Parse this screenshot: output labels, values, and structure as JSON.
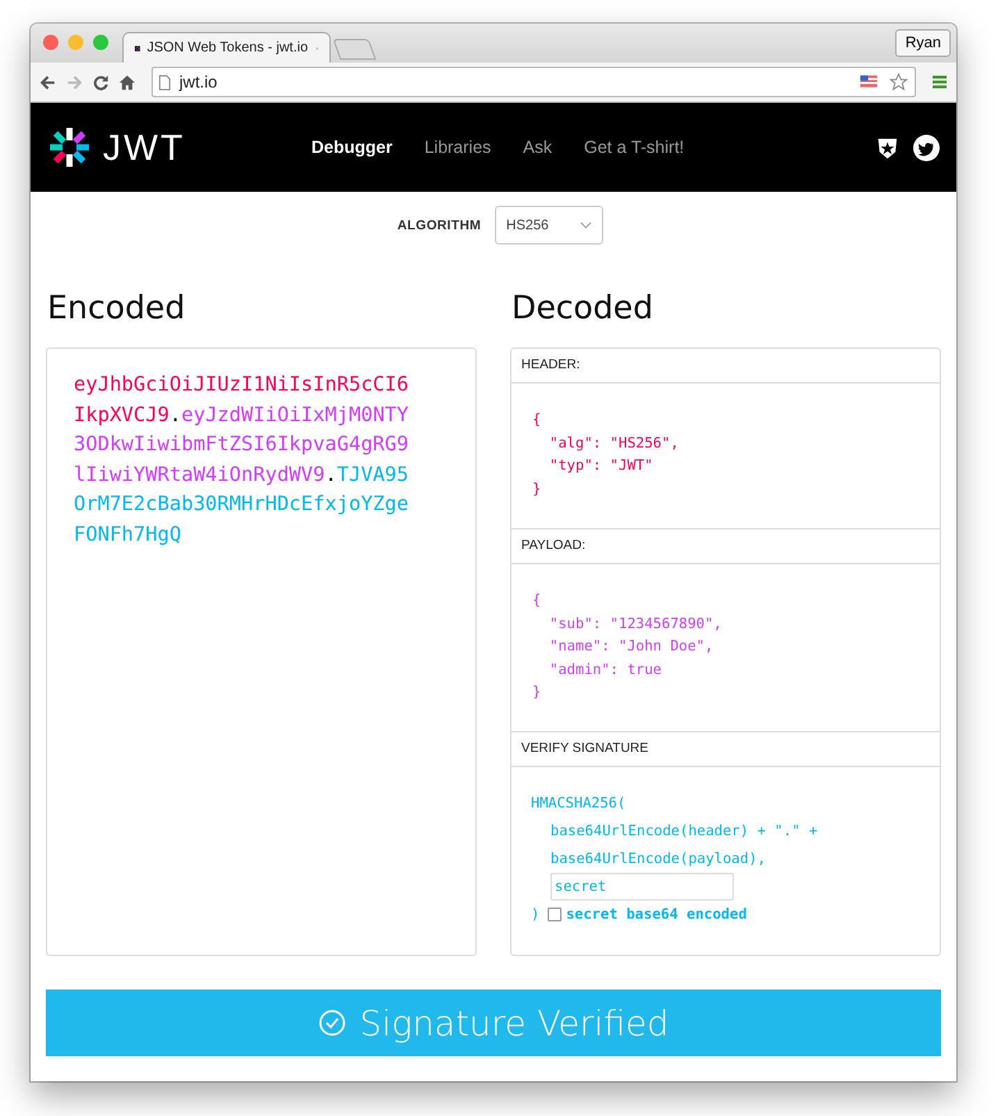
{
  "browser": {
    "tab_title": "JSON Web Tokens - jwt.io",
    "profile": "Ryan",
    "url": "jwt.io"
  },
  "navbar": {
    "logo": "JWT",
    "links": [
      {
        "label": "Debugger",
        "selected": true
      },
      {
        "label": "Libraries",
        "selected": false
      },
      {
        "label": "Ask",
        "selected": false
      },
      {
        "label": "Get a T-shirt!",
        "selected": false
      }
    ]
  },
  "algorithm": {
    "label": "ALGORITHM",
    "value": "HS256"
  },
  "encoded": {
    "title": "Encoded",
    "parts": [
      {
        "text": "eyJhbGciOiJIUzI1NiIsInR5cCI6IkpXVCJ9",
        "color": "#fb015b"
      },
      {
        "text": ".",
        "color": "#000000"
      },
      {
        "text": "eyJzdWIiOiIxMjM0NTY3ODkwIiwibmFtZSI6IkpvaG4gRG9lIiwiYWRtaW4iOnRydWV9",
        "color": "#d63aff"
      },
      {
        "text": ".",
        "color": "#000000"
      },
      {
        "text": "TJVA95OrM7E2cBab30RMHrHDcEfxjoYZgeFONFh7HgQ",
        "color": "#00b9f1"
      }
    ]
  },
  "decoded": {
    "title": "Decoded",
    "sections": [
      {
        "label": "HEADER:",
        "color": "#fb015b",
        "code": "{\n  \"alg\": \"HS256\",\n  \"typ\": \"JWT\"\n}"
      },
      {
        "label": "PAYLOAD:",
        "color": "#d63aff",
        "code": "{\n  \"sub\": \"1234567890\",\n  \"name\": \"John Doe\",\n  \"admin\": true\n}"
      }
    ],
    "signature": {
      "label": "VERIFY SIGNATURE",
      "color": "#00b9f1",
      "lines": [
        "HMACSHA256(",
        "base64UrlEncode(header) + \".\" +",
        "base64UrlEncode(payload),"
      ],
      "secret": "secret",
      "close": ")",
      "checkbox": {
        "label": "secret base64 encoded",
        "checked": false
      }
    }
  },
  "status": {
    "label": "Signature Verified",
    "verified": true
  }
}
